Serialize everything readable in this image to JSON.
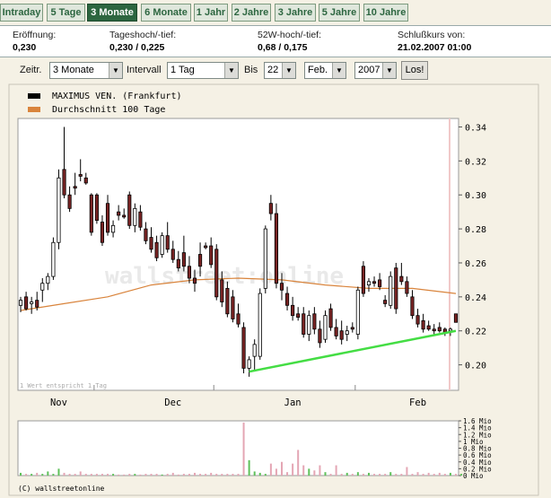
{
  "tabs": [
    {
      "label": "Intraday",
      "active": false
    },
    {
      "label": "5 Tage",
      "active": false
    },
    {
      "label": "3 Monate",
      "active": true
    },
    {
      "label": "6 Monate",
      "active": false
    },
    {
      "label": "1 Jahr",
      "active": false
    },
    {
      "label": "2 Jahre",
      "active": false
    },
    {
      "label": "3 Jahre",
      "active": false
    },
    {
      "label": "5 Jahre",
      "active": false
    },
    {
      "label": "10 Jahre",
      "active": false
    }
  ],
  "stats": [
    {
      "label": "Eröffnung:",
      "value": "0,230"
    },
    {
      "label": "Tageshoch/-tief:",
      "value": "0,230 / 0,225"
    },
    {
      "label": "52W-hoch/-tief:",
      "value": "0,68 / 0,175"
    },
    {
      "label": "Schlußkurs von:",
      "value": "21.02.2007 01:00"
    }
  ],
  "controls": {
    "zeitraum_label": "Zeitr.",
    "zeitraum_value": "3 Monate",
    "intervall_label": "Intervall",
    "intervall_value": "1 Tag",
    "bis_label": "Bis",
    "day_value": "22",
    "month_value": "Feb.",
    "year_value": "2007",
    "go_label": "Los!"
  },
  "colors": {
    "tab_active_bg": "#2d6640",
    "tab_text": "#2d6640",
    "candle_up": "#ffffff",
    "candle_down": "#7a2424",
    "average_line": "#d9843c",
    "trend_line": "#44dd44",
    "volume_up": "#5fc15a",
    "volume_down": "#e4a6b4"
  },
  "chart_data": {
    "type": "candlestick",
    "legend": [
      {
        "name": "MAXIMUS VEN. (Frankfurt)",
        "color": "#000000"
      },
      {
        "name": "Durchschnitt 100 Tage",
        "color": "#d9843c"
      }
    ],
    "watermark": "wallstreet:online",
    "note": "1 Wert entspricht 1 Tag",
    "footer": "(C) wallstreetonline",
    "ylim": [
      0.185,
      0.345
    ],
    "yticks": [
      "0.34",
      "0.32",
      "0.30",
      "0.28",
      "0.26",
      "0.24",
      "0.22",
      "0.20"
    ],
    "month_labels": [
      {
        "label": "Nov",
        "index": 7
      },
      {
        "label": "Dec",
        "index": 28
      },
      {
        "label": "Jan",
        "index": 50
      },
      {
        "label": "Feb",
        "index": 73
      }
    ],
    "month_dividers": [
      14,
      36,
      62
    ],
    "candles": [
      {
        "o": 0.235,
        "h": 0.24,
        "l": 0.231,
        "c": 0.238
      },
      {
        "o": 0.24,
        "h": 0.243,
        "l": 0.232,
        "c": 0.233
      },
      {
        "o": 0.236,
        "h": 0.24,
        "l": 0.23,
        "c": 0.237
      },
      {
        "o": 0.238,
        "h": 0.243,
        "l": 0.232,
        "c": 0.234
      },
      {
        "o": 0.244,
        "h": 0.251,
        "l": 0.237,
        "c": 0.248
      },
      {
        "o": 0.248,
        "h": 0.254,
        "l": 0.244,
        "c": 0.252
      },
      {
        "o": 0.252,
        "h": 0.275,
        "l": 0.25,
        "c": 0.272
      },
      {
        "o": 0.272,
        "h": 0.315,
        "l": 0.268,
        "c": 0.31
      },
      {
        "o": 0.315,
        "h": 0.34,
        "l": 0.298,
        "c": 0.3
      },
      {
        "o": 0.3,
        "h": 0.305,
        "l": 0.29,
        "c": 0.292
      },
      {
        "o": 0.305,
        "h": 0.313,
        "l": 0.3,
        "c": 0.304
      },
      {
        "o": 0.312,
        "h": 0.321,
        "l": 0.308,
        "c": 0.311
      },
      {
        "o": 0.31,
        "h": 0.313,
        "l": 0.306,
        "c": 0.307
      },
      {
        "o": 0.3,
        "h": 0.301,
        "l": 0.276,
        "c": 0.278
      },
      {
        "o": 0.3,
        "h": 0.301,
        "l": 0.283,
        "c": 0.285
      },
      {
        "o": 0.284,
        "h": 0.288,
        "l": 0.27,
        "c": 0.272
      },
      {
        "o": 0.295,
        "h": 0.3,
        "l": 0.276,
        "c": 0.278
      },
      {
        "o": 0.278,
        "h": 0.285,
        "l": 0.275,
        "c": 0.282
      },
      {
        "o": 0.29,
        "h": 0.294,
        "l": 0.285,
        "c": 0.288
      },
      {
        "o": 0.288,
        "h": 0.292,
        "l": 0.286,
        "c": 0.287
      },
      {
        "o": 0.3,
        "h": 0.302,
        "l": 0.28,
        "c": 0.282
      },
      {
        "o": 0.282,
        "h": 0.295,
        "l": 0.278,
        "c": 0.292
      },
      {
        "o": 0.29,
        "h": 0.294,
        "l": 0.279,
        "c": 0.281
      },
      {
        "o": 0.28,
        "h": 0.284,
        "l": 0.271,
        "c": 0.273
      },
      {
        "o": 0.275,
        "h": 0.281,
        "l": 0.266,
        "c": 0.268
      },
      {
        "o": 0.272,
        "h": 0.276,
        "l": 0.261,
        "c": 0.263
      },
      {
        "o": 0.265,
        "h": 0.278,
        "l": 0.263,
        "c": 0.276
      },
      {
        "o": 0.276,
        "h": 0.284,
        "l": 0.266,
        "c": 0.268
      },
      {
        "o": 0.268,
        "h": 0.273,
        "l": 0.26,
        "c": 0.262
      },
      {
        "o": 0.262,
        "h": 0.267,
        "l": 0.255,
        "c": 0.257
      },
      {
        "o": 0.266,
        "h": 0.276,
        "l": 0.255,
        "c": 0.258
      },
      {
        "o": 0.258,
        "h": 0.264,
        "l": 0.248,
        "c": 0.251
      },
      {
        "o": 0.251,
        "h": 0.256,
        "l": 0.243,
        "c": 0.248
      },
      {
        "o": 0.265,
        "h": 0.272,
        "l": 0.252,
        "c": 0.258
      },
      {
        "o": 0.27,
        "h": 0.272,
        "l": 0.268,
        "c": 0.269
      },
      {
        "o": 0.27,
        "h": 0.275,
        "l": 0.257,
        "c": 0.259
      },
      {
        "o": 0.268,
        "h": 0.271,
        "l": 0.238,
        "c": 0.24
      },
      {
        "o": 0.25,
        "h": 0.255,
        "l": 0.234,
        "c": 0.237
      },
      {
        "o": 0.245,
        "h": 0.249,
        "l": 0.228,
        "c": 0.23
      },
      {
        "o": 0.24,
        "h": 0.244,
        "l": 0.225,
        "c": 0.227
      },
      {
        "o": 0.23,
        "h": 0.236,
        "l": 0.222,
        "c": 0.224
      },
      {
        "o": 0.222,
        "h": 0.225,
        "l": 0.195,
        "c": 0.198
      },
      {
        "o": 0.198,
        "h": 0.205,
        "l": 0.193,
        "c": 0.203
      },
      {
        "o": 0.205,
        "h": 0.215,
        "l": 0.197,
        "c": 0.212
      },
      {
        "o": 0.205,
        "h": 0.245,
        "l": 0.203,
        "c": 0.242
      },
      {
        "o": 0.245,
        "h": 0.282,
        "l": 0.242,
        "c": 0.28
      },
      {
        "o": 0.295,
        "h": 0.3,
        "l": 0.285,
        "c": 0.289
      },
      {
        "o": 0.289,
        "h": 0.295,
        "l": 0.245,
        "c": 0.248
      },
      {
        "o": 0.248,
        "h": 0.254,
        "l": 0.238,
        "c": 0.244
      },
      {
        "o": 0.242,
        "h": 0.246,
        "l": 0.232,
        "c": 0.235
      },
      {
        "o": 0.235,
        "h": 0.24,
        "l": 0.226,
        "c": 0.229
      },
      {
        "o": 0.23,
        "h": 0.234,
        "l": 0.226,
        "c": 0.228
      },
      {
        "o": 0.23,
        "h": 0.234,
        "l": 0.216,
        "c": 0.218
      },
      {
        "o": 0.218,
        "h": 0.232,
        "l": 0.214,
        "c": 0.229
      },
      {
        "o": 0.23,
        "h": 0.234,
        "l": 0.218,
        "c": 0.221
      },
      {
        "o": 0.221,
        "h": 0.226,
        "l": 0.21,
        "c": 0.213
      },
      {
        "o": 0.215,
        "h": 0.232,
        "l": 0.213,
        "c": 0.229
      },
      {
        "o": 0.233,
        "h": 0.236,
        "l": 0.22,
        "c": 0.222
      },
      {
        "o": 0.222,
        "h": 0.227,
        "l": 0.215,
        "c": 0.217
      },
      {
        "o": 0.22,
        "h": 0.226,
        "l": 0.212,
        "c": 0.215
      },
      {
        "o": 0.218,
        "h": 0.223,
        "l": 0.214,
        "c": 0.22
      },
      {
        "o": 0.222,
        "h": 0.225,
        "l": 0.219,
        "c": 0.221
      },
      {
        "o": 0.218,
        "h": 0.246,
        "l": 0.215,
        "c": 0.244
      },
      {
        "o": 0.258,
        "h": 0.261,
        "l": 0.24,
        "c": 0.242
      },
      {
        "o": 0.247,
        "h": 0.251,
        "l": 0.243,
        "c": 0.249
      },
      {
        "o": 0.249,
        "h": 0.252,
        "l": 0.246,
        "c": 0.248
      },
      {
        "o": 0.25,
        "h": 0.254,
        "l": 0.244,
        "c": 0.246
      },
      {
        "o": 0.238,
        "h": 0.241,
        "l": 0.234,
        "c": 0.236
      },
      {
        "o": 0.235,
        "h": 0.255,
        "l": 0.233,
        "c": 0.252
      },
      {
        "o": 0.257,
        "h": 0.26,
        "l": 0.23,
        "c": 0.233
      },
      {
        "o": 0.252,
        "h": 0.26,
        "l": 0.247,
        "c": 0.249
      },
      {
        "o": 0.249,
        "h": 0.252,
        "l": 0.24,
        "c": 0.242
      },
      {
        "o": 0.24,
        "h": 0.244,
        "l": 0.227,
        "c": 0.229
      },
      {
        "o": 0.229,
        "h": 0.233,
        "l": 0.222,
        "c": 0.224
      },
      {
        "o": 0.226,
        "h": 0.23,
        "l": 0.219,
        "c": 0.221
      },
      {
        "o": 0.223,
        "h": 0.226,
        "l": 0.22,
        "c": 0.221
      },
      {
        "o": 0.221,
        "h": 0.224,
        "l": 0.218,
        "c": 0.22
      },
      {
        "o": 0.222,
        "h": 0.225,
        "l": 0.219,
        "c": 0.22
      },
      {
        "o": 0.221,
        "h": 0.222,
        "l": 0.217,
        "c": 0.219
      },
      {
        "o": 0.22,
        "h": 0.222,
        "l": 0.217,
        "c": 0.221
      },
      {
        "o": 0.23,
        "h": 0.23,
        "l": 0.225,
        "c": 0.225
      }
    ],
    "moving_average": [
      [
        0,
        0.232
      ],
      [
        8,
        0.236
      ],
      [
        16,
        0.24
      ],
      [
        24,
        0.247
      ],
      [
        32,
        0.25
      ],
      [
        40,
        0.251
      ],
      [
        48,
        0.25
      ],
      [
        56,
        0.247
      ],
      [
        64,
        0.245
      ],
      [
        72,
        0.245
      ],
      [
        80,
        0.242
      ]
    ],
    "trend_line": [
      [
        42,
        0.196
      ],
      [
        80,
        0.22
      ]
    ],
    "volume_ylim": [
      0,
      1.6
    ],
    "volume_ticks": [
      "1.6 Mio",
      "1.4 Mio",
      "1.2 Mio",
      "1 Mio",
      "0.8 Mio",
      "0.6 Mio",
      "0.4 Mio",
      "0.2 Mio",
      "0 Mio"
    ],
    "volume": [
      0.08,
      0.05,
      0.05,
      0.08,
      0.05,
      0.12,
      0.05,
      0.2,
      0.08,
      0.05,
      0.05,
      0.12,
      0.05,
      0.05,
      0.05,
      0.05,
      0.05,
      0.05,
      0.03,
      0.03,
      0.05,
      0.05,
      0.03,
      0.05,
      0.05,
      0.05,
      0.03,
      0.05,
      0.08,
      0.03,
      0.05,
      0.05,
      0.08,
      0.05,
      0.05,
      0.08,
      0.05,
      0.05,
      0.05,
      0.05,
      0.05,
      1.55,
      0.45,
      0.12,
      0.08,
      0.05,
      0.35,
      0.2,
      0.4,
      0.1,
      0.35,
      0.75,
      0.3,
      0.2,
      0.15,
      0.3,
      0.1,
      0.05,
      0.3,
      0.05,
      0.08,
      0.05,
      0.1,
      0.05,
      0.08,
      0.05,
      0.05,
      0.05,
      0.1,
      0.05,
      0.05,
      0.25,
      0.05,
      0.1,
      0.05,
      0.08,
      0.05,
      0.08,
      0.05,
      0.08,
      0.05,
      0.05
    ]
  }
}
